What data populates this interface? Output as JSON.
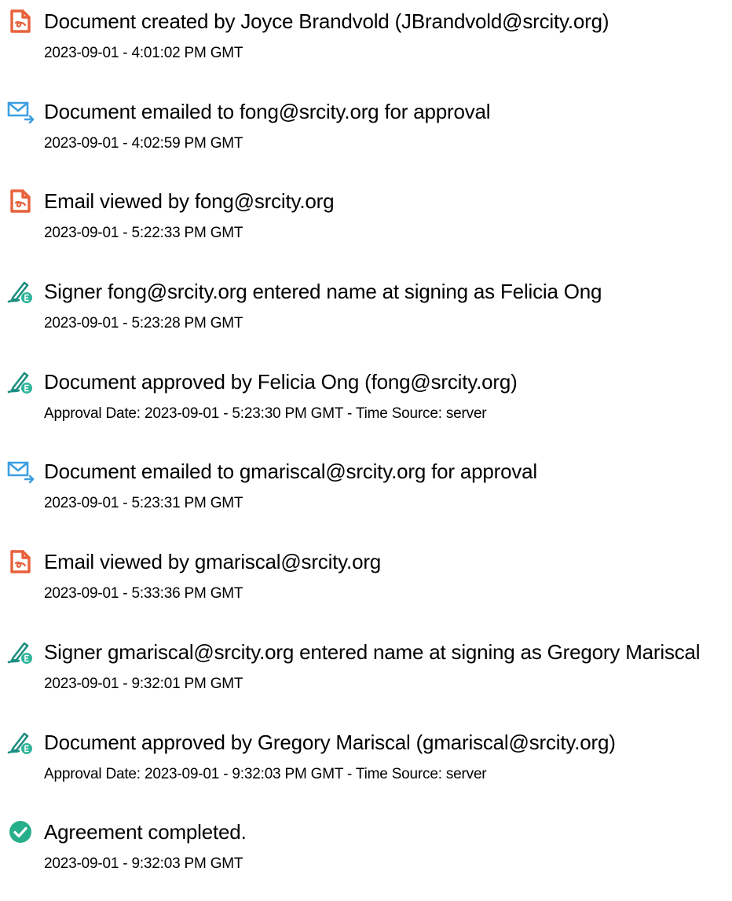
{
  "colors": {
    "doc_icon": "#e8613c",
    "email_icon": "#3d9fe0",
    "sign_pen": "#1b8e80",
    "sign_badge": "#2fb59a",
    "complete_icon": "#27ae8a"
  },
  "events": [
    {
      "icon": "document-icon",
      "title": "Document created by Joyce Brandvold (JBrandvold@srcity.org)",
      "detail": "2023-09-01 - 4:01:02 PM GMT"
    },
    {
      "icon": "email-sent-icon",
      "title": "Document emailed to fong@srcity.org for approval",
      "detail": "2023-09-01 - 4:02:59 PM GMT"
    },
    {
      "icon": "document-icon",
      "title": "Email viewed by fong@srcity.org",
      "detail": "2023-09-01 - 5:22:33 PM GMT"
    },
    {
      "icon": "e-sign-icon",
      "title": "Signer fong@srcity.org entered name at signing as Felicia Ong",
      "detail": "2023-09-01 - 5:23:28 PM GMT"
    },
    {
      "icon": "e-sign-icon",
      "title": "Document approved by Felicia Ong (fong@srcity.org)",
      "detail": "Approval Date: 2023-09-01 - 5:23:30 PM GMT - Time Source: server"
    },
    {
      "icon": "email-sent-icon",
      "title": "Document emailed to gmariscal@srcity.org for approval",
      "detail": "2023-09-01 - 5:23:31 PM GMT"
    },
    {
      "icon": "document-icon",
      "title": "Email viewed by gmariscal@srcity.org",
      "detail": "2023-09-01 - 5:33:36 PM GMT"
    },
    {
      "icon": "e-sign-icon",
      "title": "Signer gmariscal@srcity.org entered name at signing as Gregory Mariscal",
      "detail": "2023-09-01 - 9:32:01 PM GMT"
    },
    {
      "icon": "e-sign-icon",
      "title": "Document approved by Gregory Mariscal (gmariscal@srcity.org)",
      "detail": "Approval Date: 2023-09-01 - 9:32:03 PM GMT - Time Source: server"
    },
    {
      "icon": "check-circle-icon",
      "title": "Agreement completed.",
      "detail": "2023-09-01 - 9:32:03 PM GMT"
    }
  ]
}
